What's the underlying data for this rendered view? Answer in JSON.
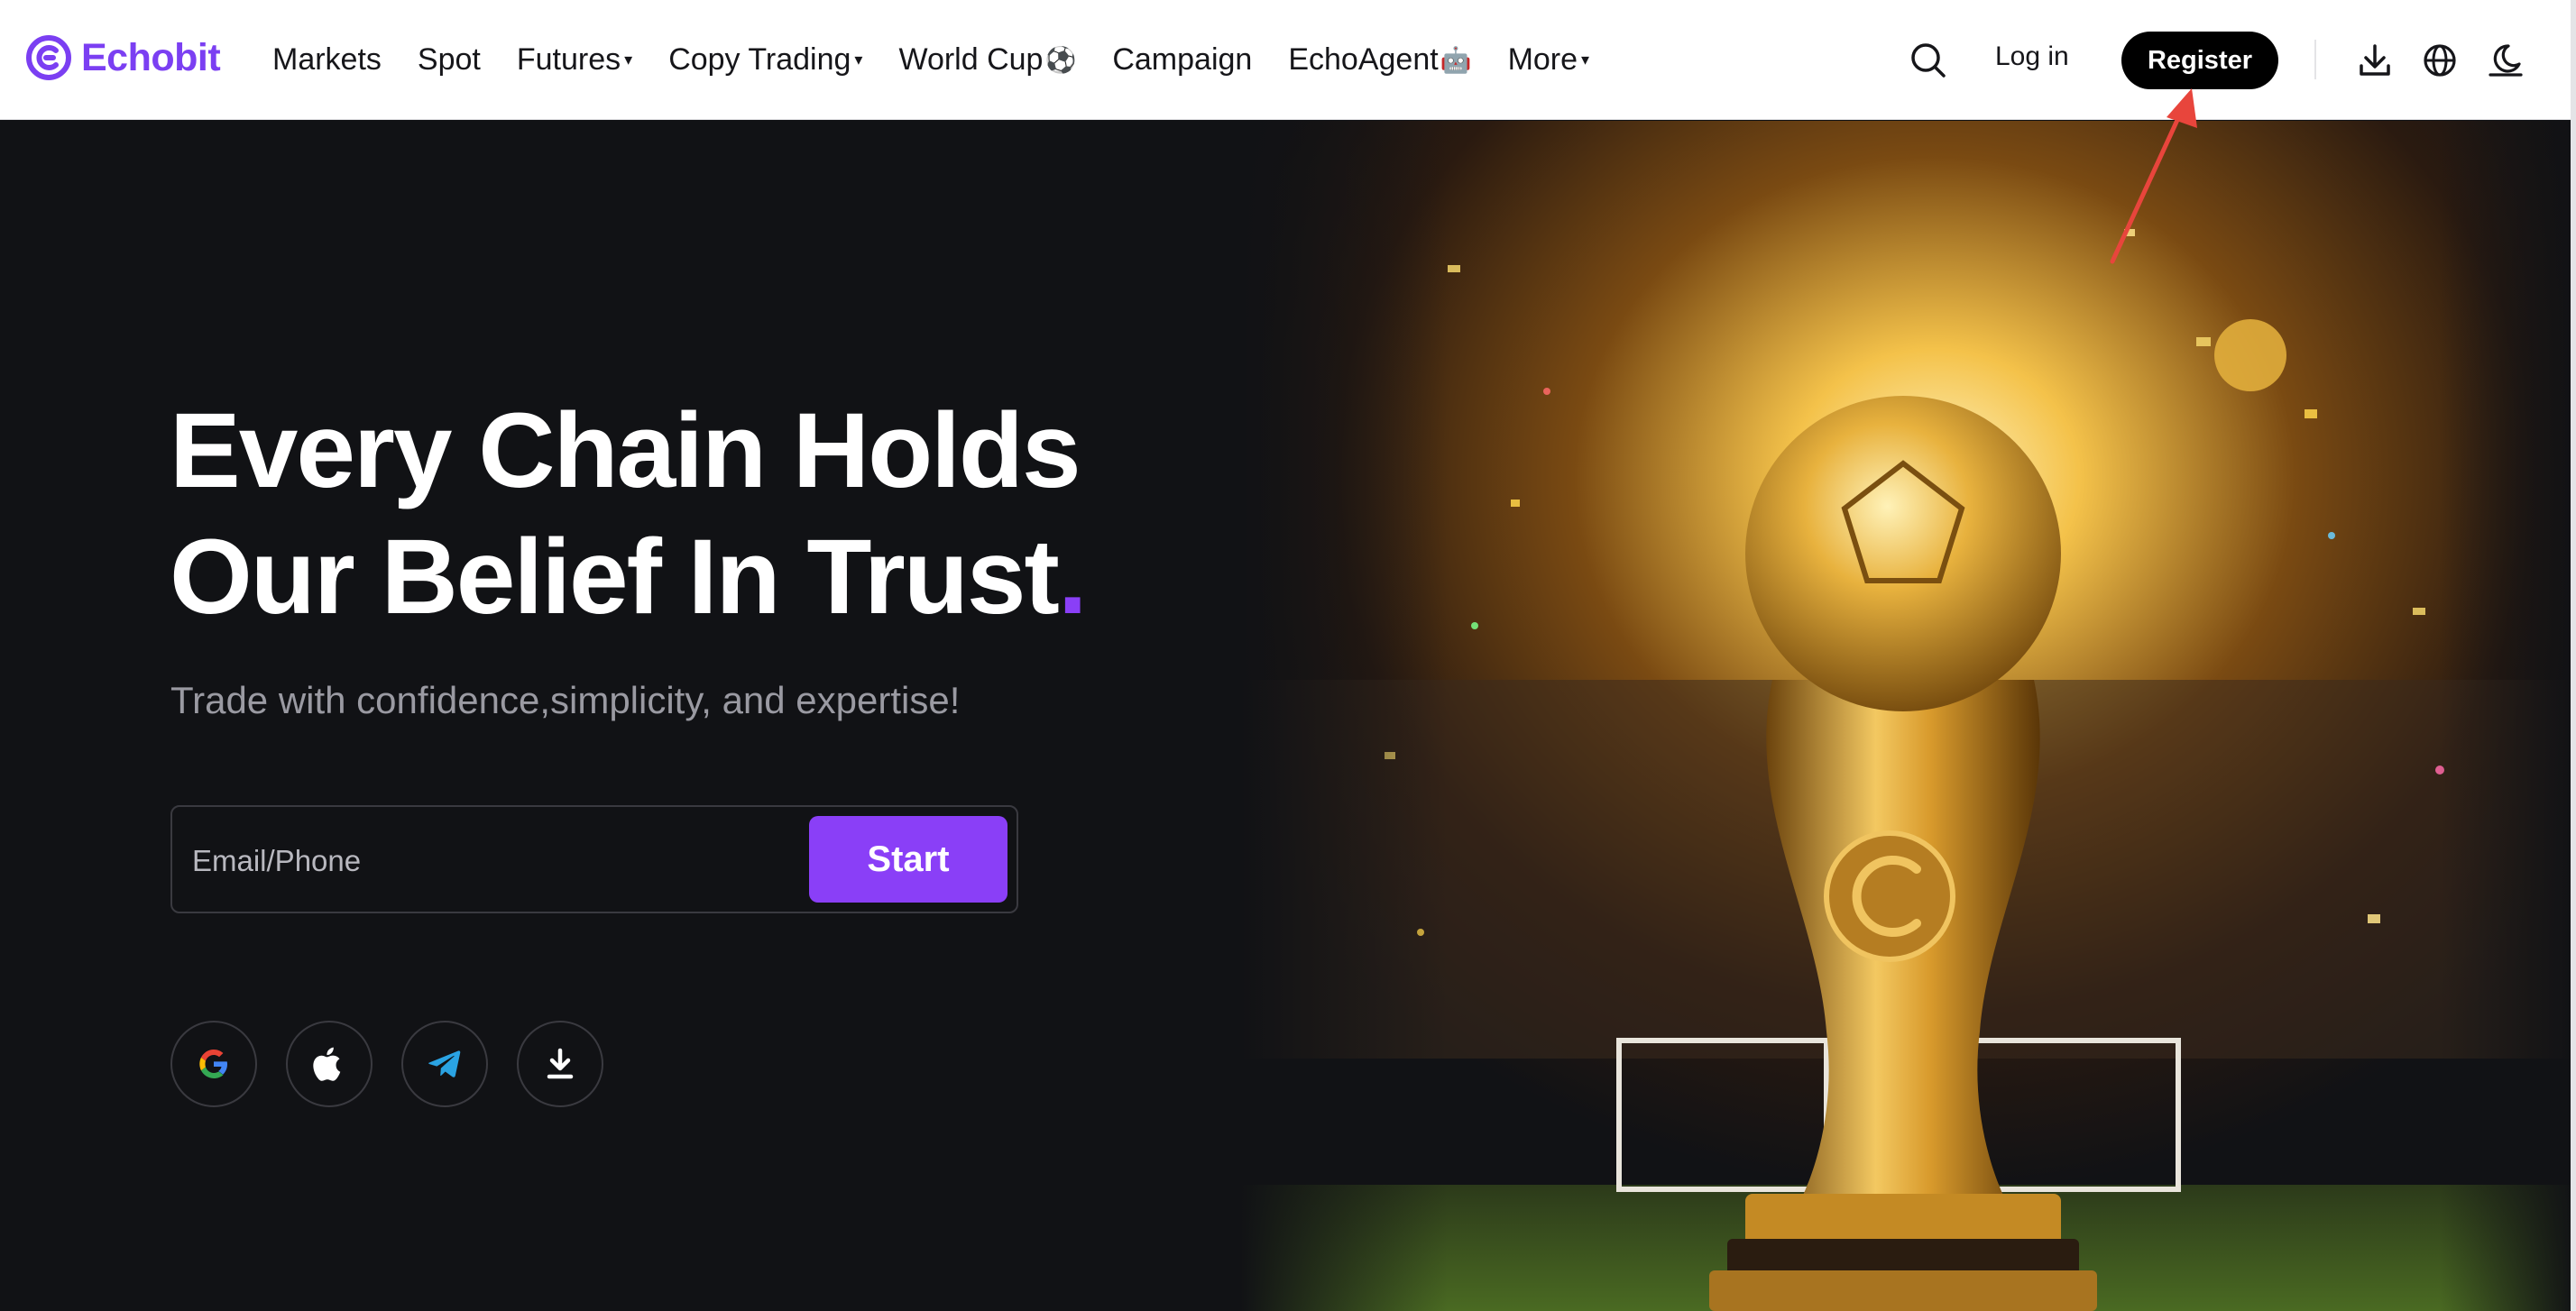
{
  "brand": {
    "name": "Echobit",
    "accent": "#8a3ff7",
    "logo_color": "#7b3ff2"
  },
  "nav": {
    "items": [
      {
        "label": "Markets",
        "caret": false,
        "emoji": ""
      },
      {
        "label": "Spot",
        "caret": false,
        "emoji": ""
      },
      {
        "label": "Futures",
        "caret": true,
        "emoji": ""
      },
      {
        "label": "Copy Trading",
        "caret": true,
        "emoji": ""
      },
      {
        "label": "World Cup",
        "caret": false,
        "emoji": "⚽"
      },
      {
        "label": "Campaign",
        "caret": false,
        "emoji": ""
      },
      {
        "label": "EchoAgent",
        "caret": false,
        "emoji": "🤖"
      },
      {
        "label": "More",
        "caret": true,
        "emoji": ""
      }
    ],
    "caret_glyph": "▾"
  },
  "header": {
    "login_label": "Log in",
    "register_label": "Register",
    "icons": [
      "search-icon",
      "download-icon",
      "globe-icon",
      "theme-moon-icon"
    ]
  },
  "hero": {
    "headline_line1": "Every Chain Holds",
    "headline_line2": "Our Belief In Trust",
    "headline_dot": ".",
    "subline": "Trade with confidence,simplicity, and expertise!",
    "input_placeholder": "Email/Phone",
    "start_label": "Start",
    "social_icons": [
      "google-icon",
      "apple-icon",
      "telegram-icon",
      "download-app-icon"
    ]
  },
  "annotation": {
    "arrow_color": "#e8453c"
  }
}
